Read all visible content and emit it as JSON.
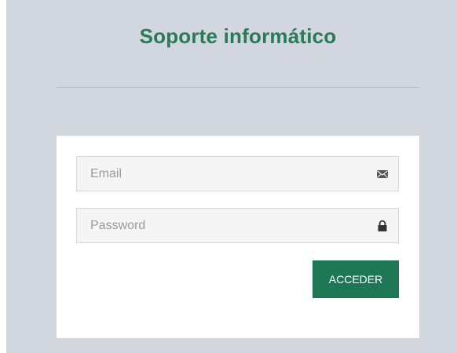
{
  "header": {
    "title": "Soporte informático"
  },
  "login_form": {
    "email": {
      "value": "",
      "placeholder": "Email",
      "icon": "envelope-icon"
    },
    "password": {
      "value": "",
      "placeholder": "Password",
      "icon": "lock-icon"
    },
    "submit_label": "ACCEDER"
  },
  "colors": {
    "background": "#d2d6de",
    "brand": "#2a7a57",
    "button": "#1d7654",
    "card": "#ffffff",
    "field": "#f5f5f5"
  }
}
